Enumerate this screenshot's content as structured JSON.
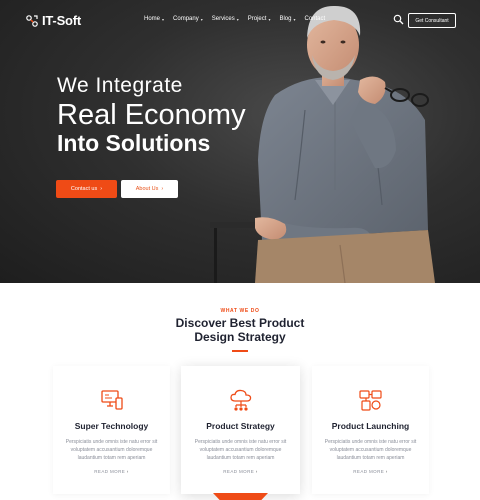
{
  "nav": {
    "brand": "IT-Soft",
    "menu": [
      {
        "label": "Home",
        "has_caret": true
      },
      {
        "label": "Company",
        "has_caret": true
      },
      {
        "label": "Services",
        "has_caret": true
      },
      {
        "label": "Project",
        "has_caret": true
      },
      {
        "label": "Blog",
        "has_caret": true
      },
      {
        "label": "Contact",
        "has_caret": false
      }
    ],
    "caret_glyph": "▾",
    "cta": "Get Consultant",
    "search_icon": "search-icon"
  },
  "hero": {
    "line1": "We Integrate",
    "line2": "Real Economy",
    "line3": "Into Solutions",
    "primary_button": "Contact us",
    "secondary_button": "About Us",
    "arrow": "›"
  },
  "section": {
    "eyebrow": "WHAT WE DO",
    "title_line1": "Discover Best Product",
    "title_line2": "Design Strategy"
  },
  "cards": [
    {
      "title": "Super Technology",
      "icon": "monitor-icon",
      "text_l1": "Perspiciatis unde omnis iste natu error sit",
      "text_l2": "voluptatem accusantium doloremque",
      "text_l3": "laudantium totam rem aperiam",
      "link": "READ MORE"
    },
    {
      "title": "Product Strategy",
      "icon": "cloud-network-icon",
      "text_l1": "Perspiciatis unde omnis iste natu error sit",
      "text_l2": "voluptatem accusantium doloremque",
      "text_l3": "laudantium totam rem aperiam",
      "link": "READ MORE"
    },
    {
      "title": "Product Launching",
      "icon": "devices-icon",
      "text_l1": "Perspiciatis unde omnis iste natu error sit",
      "text_l2": "voluptatem accusantium doloremque",
      "text_l3": "laudantium totam rem aperiam",
      "link": "READ MORE"
    }
  ],
  "colors": {
    "accent": "#ef4b16",
    "dark": "#1f2230",
    "hero_bg": "#2f2f2f"
  }
}
